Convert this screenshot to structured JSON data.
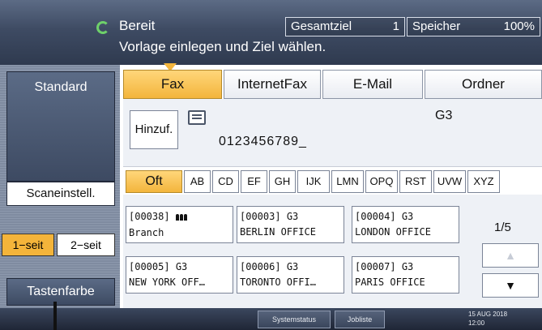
{
  "header": {
    "status": "Bereit",
    "instruction": "Vorlage einlegen und Ziel wählen.",
    "total_dest_label": "Gesamtziel",
    "total_dest_value": "1",
    "memory_label": "Speicher",
    "memory_value": "100%"
  },
  "left_panel": {
    "standard_label": "Standard",
    "scan_settings_label": "Scaneinstell.",
    "one_sided_label": "1−seit",
    "two_sided_label": "2−seit",
    "key_color_label": "Tastenfarbe"
  },
  "tabs": [
    {
      "label": "Fax",
      "active": true
    },
    {
      "label": "InternetFax",
      "active": false
    },
    {
      "label": "E-Mail",
      "active": false
    },
    {
      "label": "Ordner",
      "active": false
    }
  ],
  "destination": {
    "add_label": "Hinzuf.",
    "fax_number": "0123456789_",
    "line_type": "G3"
  },
  "index_tabs": [
    "Oft",
    "AB",
    "CD",
    "EF",
    "GH",
    "IJK",
    "LMN",
    "OPQ",
    "RST",
    "UVW",
    "XYZ"
  ],
  "entries": [
    {
      "id": "[00038]",
      "type": "",
      "name": "Branch",
      "group": true
    },
    {
      "id": "[00003]",
      "type": "G3",
      "name": "BERLIN OFFICE"
    },
    {
      "id": "[00004]",
      "type": "G3",
      "name": "LONDON OFFICE"
    },
    {
      "id": "[00005]",
      "type": "G3",
      "name": "NEW YORK OFF…"
    },
    {
      "id": "[00006]",
      "type": "G3",
      "name": "TORONTO OFFI…"
    },
    {
      "id": "[00007]",
      "type": "G3",
      "name": "PARIS OFFICE"
    }
  ],
  "pagination": {
    "page": "1/5",
    "up_symbol": "▲",
    "down_symbol": "▼"
  },
  "bottom": {
    "system_status_label": "Systemstatus",
    "job_list_label": "Jobliste",
    "date": "15 AUG  2018",
    "time": "12:00"
  }
}
